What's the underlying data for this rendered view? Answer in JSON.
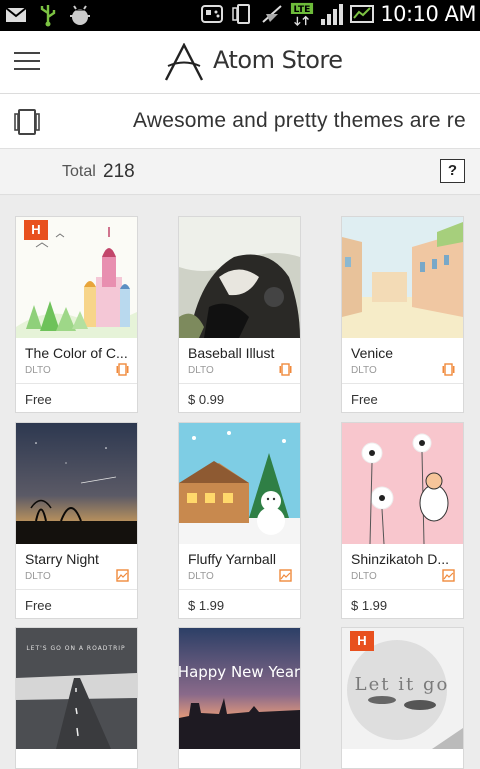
{
  "status_bar": {
    "time": "10:10 AM",
    "network": "LTE",
    "icons_left": [
      "email-icon",
      "usb-icon",
      "android-debug-icon"
    ],
    "icons_right": [
      "gamepad-icon",
      "vibrate-icon",
      "wifi-off-icon",
      "lte-icon",
      "signal-icon",
      "battery-icon"
    ]
  },
  "header": {
    "title": "Atom Store",
    "menu_icon": "hamburger-menu-icon",
    "logo_icon": "atom-logo-icon"
  },
  "banner": {
    "icon": "theme-icon",
    "text": "Awesome and pretty themes are released"
  },
  "total": {
    "label": "Total",
    "count": "218",
    "help_label": "?"
  },
  "colors": {
    "accent": "#e8501e",
    "status_bar_bg": "#000000",
    "type_icon": "#f08a3c"
  },
  "items": [
    {
      "name": "The Color of C...",
      "author": "DLTO",
      "price": "Free",
      "type": "theme",
      "hot": true,
      "badge": "H"
    },
    {
      "name": "Baseball Illust",
      "author": "DLTO",
      "price": "$  0.99",
      "type": "theme",
      "hot": false
    },
    {
      "name": "Venice",
      "author": "DLTO",
      "price": "Free",
      "type": "theme",
      "hot": false
    },
    {
      "name": "Starry Night",
      "author": "DLTO",
      "price": "Free",
      "type": "wallpaper",
      "hot": false
    },
    {
      "name": "Fluffy Yarnball",
      "author": "DLTO",
      "price": "$  1.99",
      "type": "wallpaper",
      "hot": false
    },
    {
      "name": "Shinzikatoh D...",
      "author": "DLTO",
      "price": "$  1.99",
      "type": "wallpaper",
      "hot": false
    },
    {
      "name": "",
      "author": "",
      "price": "",
      "type": "",
      "hot": false,
      "thumb_text": "LET'S GO ON A ROADTRIP"
    },
    {
      "name": "",
      "author": "",
      "price": "",
      "type": "",
      "hot": false,
      "thumb_text": "Happy New Year"
    },
    {
      "name": "",
      "author": "",
      "price": "",
      "type": "",
      "hot": true,
      "badge": "H",
      "thumb_text": "Let it go"
    }
  ]
}
